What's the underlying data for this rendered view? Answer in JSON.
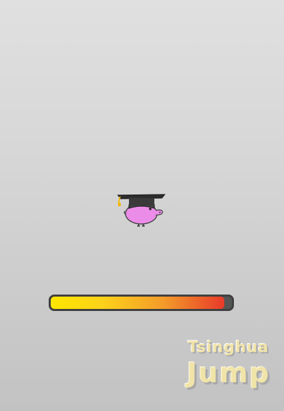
{
  "game": {
    "logo_line_1": "Tsinghua",
    "logo_line_2": "Jump"
  },
  "power_bar": {
    "fill_fraction": 0.96
  },
  "character": {
    "name": "pink-blob-with-graduation-cap",
    "body_color": "#ec8ce9",
    "cap_color": "#2e2e2e",
    "tassel_color": "#f1b700"
  },
  "colors": {
    "background_top": "#e0e0e0",
    "background_bottom": "#c2c2c2",
    "bar_start": "#ffe600",
    "bar_end": "#e83a2a",
    "logo_text": "#f1e4a9"
  }
}
